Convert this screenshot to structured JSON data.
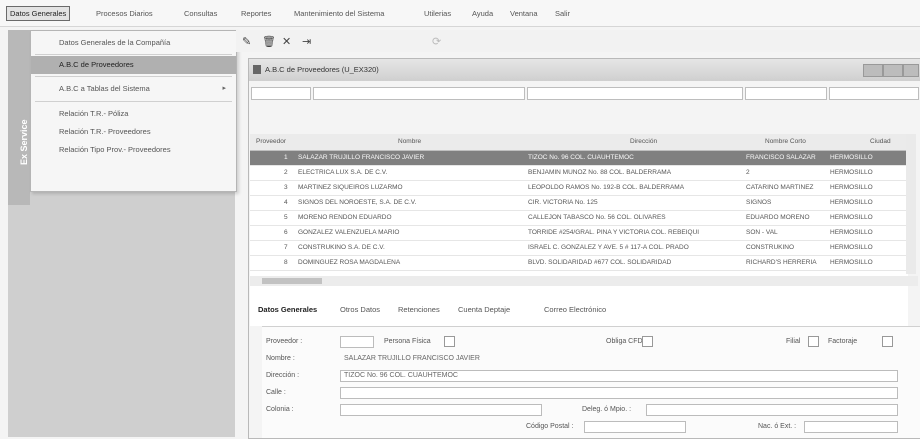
{
  "menu": {
    "items": [
      "Datos Generales",
      "Procesos Diarios",
      "Consultas",
      "Reportes",
      "Mantenimiento del Sistema",
      "Utilerias",
      "Ayuda",
      "Ventana",
      "Salir"
    ]
  },
  "side_strip_label": "Ex Service",
  "dropdown": {
    "items": [
      "Datos Generales de la Compañía",
      "A.B.C de Proveedores",
      "A.B.C a Tablas del Sistema",
      "Relación T.R.- Póliza",
      "Relación T.R.- Proveedores",
      "Relación Tipo Prov.- Proveedores"
    ],
    "submenu_arrow": "▸"
  },
  "window": {
    "title": "A.B.C de Proveedores (U_EX320)"
  },
  "grid": {
    "headers": [
      "Proveedor",
      "Nombre",
      "Dirección",
      "Nombre Corto",
      "Ciudad"
    ],
    "rows": [
      {
        "num": "1",
        "nombre": "SALAZAR TRUJILLO FRANCISCO JAVIER",
        "direccion": "TIZOC No. 96 COL. CUAUHTEMOC",
        "corto": "FRANCISCO SALAZAR",
        "ciudad": "HERMOSILLO"
      },
      {
        "num": "2",
        "nombre": "ELECTRICA LUX S.A. DE C.V.",
        "direccion": "BENJAMIN MUÑOZ No. 88 COL. BALDERRAMA",
        "corto": "2",
        "ciudad": "HERMOSILLO"
      },
      {
        "num": "3",
        "nombre": "MARTINEZ SIQUEIROS LUZARMO",
        "direccion": "LEOPOLDO RAMOS No. 192-B COL. BALDERRAMA",
        "corto": "CATARINO MARTINEZ",
        "ciudad": "HERMOSILLO"
      },
      {
        "num": "4",
        "nombre": "SIGNOS DEL NOROESTE, S.A. DE C.V.",
        "direccion": "CIR. VICTORIA No. 125",
        "corto": "SIGNOS",
        "ciudad": "HERMOSILLO"
      },
      {
        "num": "5",
        "nombre": "MORENO RENDON EDUARDO",
        "direccion": "CALLEJON TABASCO No. 56 COL. OLIVARES",
        "corto": "EDUARDO MORENO",
        "ciudad": "HERMOSILLO"
      },
      {
        "num": "6",
        "nombre": "GONZALEZ VALENZUELA MARIO",
        "direccion": "TORRIDE #254/GRAL. PIÑA Y VICTORIA COL. REBEIQUI",
        "corto": "SON - VAL",
        "ciudad": "HERMOSILLO"
      },
      {
        "num": "7",
        "nombre": "CONSTRUKINO S.A. DE C.V.",
        "direccion": "ISRAEL C. GONZALEZ Y AVE. 5 # 117-A COL. PRADO",
        "corto": "CONSTRUKINO",
        "ciudad": "HERMOSILLO"
      },
      {
        "num": "8",
        "nombre": "DOMINGUEZ ROSA MAGDALENA",
        "direccion": "BLVD. SOLIDARIDAD #677 COL. SOLIDARIDAD",
        "corto": "RICHARD'S HERRERIA",
        "ciudad": "HERMOSILLO"
      }
    ]
  },
  "tabs": [
    "Datos Generales",
    "Otros Datos",
    "Retenciones",
    "Cuenta Deptaje",
    "Correo Electrónico"
  ],
  "form": {
    "proveedor_label": "Proveedor :",
    "persona_fisica_label": "Persona Física",
    "obliga_cfdi_label": "Obliga CFDI",
    "filial_label": "Filial",
    "factoraje_label": "Factoraje",
    "nombre_label": "Nombre :",
    "nombre_value": "SALAZAR TRUJILLO FRANCISCO JAVIER",
    "direccion_label": "Dirección :",
    "direccion_value": "TIZOC No. 96 COL. CUAUHTEMOC",
    "calle_label": "Calle :",
    "colonia_label": "Colonia :",
    "deleg_label": "Deleg. ó Mpio. :",
    "codigo_postal_label": "Código Postal :",
    "nac_label": "Nac. ó Ext. :"
  }
}
